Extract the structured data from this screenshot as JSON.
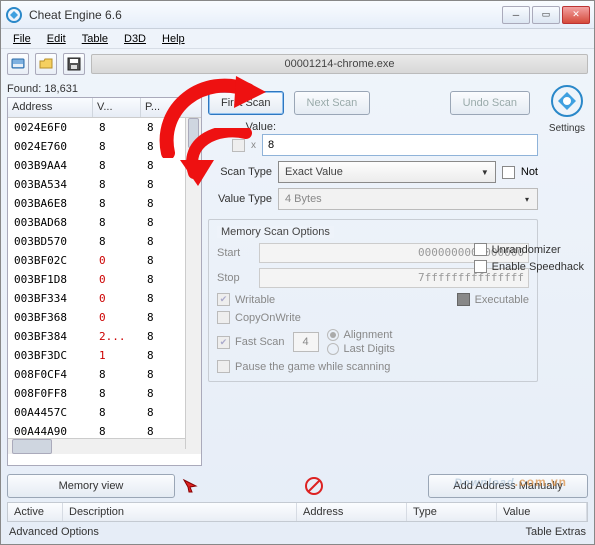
{
  "window": {
    "title": "Cheat Engine 6.6"
  },
  "menu": {
    "file": "File",
    "edit": "Edit",
    "table": "Table",
    "d3d": "D3D",
    "help": "Help"
  },
  "process": "00001214-chrome.exe",
  "found": {
    "label": "Found:",
    "count": "18,631"
  },
  "columns": {
    "address": "Address",
    "value": "V...",
    "prev": "P..."
  },
  "rows": [
    {
      "a": "0024E6F0",
      "v": "8",
      "p": "8",
      "r": false
    },
    {
      "a": "0024E760",
      "v": "8",
      "p": "8",
      "r": false
    },
    {
      "a": "003B9AA4",
      "v": "8",
      "p": "8",
      "r": false
    },
    {
      "a": "003BA534",
      "v": "8",
      "p": "8",
      "r": false
    },
    {
      "a": "003BA6E8",
      "v": "8",
      "p": "8",
      "r": false
    },
    {
      "a": "003BAD68",
      "v": "8",
      "p": "8",
      "r": false
    },
    {
      "a": "003BD570",
      "v": "8",
      "p": "8",
      "r": false
    },
    {
      "a": "003BF02C",
      "v": "0",
      "p": "8",
      "r": true
    },
    {
      "a": "003BF1D8",
      "v": "0",
      "p": "8",
      "r": true
    },
    {
      "a": "003BF334",
      "v": "0",
      "p": "8",
      "r": true
    },
    {
      "a": "003BF368",
      "v": "0",
      "p": "8",
      "r": true
    },
    {
      "a": "003BF384",
      "v": "2...",
      "p": "8",
      "r": true
    },
    {
      "a": "003BF3DC",
      "v": "1",
      "p": "8",
      "r": true
    },
    {
      "a": "008F0CF4",
      "v": "8",
      "p": "8",
      "r": false
    },
    {
      "a": "008F0FF8",
      "v": "8",
      "p": "8",
      "r": false
    },
    {
      "a": "00A4457C",
      "v": "8",
      "p": "8",
      "r": false
    },
    {
      "a": "00A44A90",
      "v": "8",
      "p": "8",
      "r": false
    }
  ],
  "scan": {
    "first": "First Scan",
    "next": "Next Scan",
    "undo": "Undo Scan",
    "settings": "Settings",
    "value_label": "Value:",
    "value": "8",
    "hex_chk": "x",
    "scantype_label": "Scan Type",
    "scantype": "Exact Value",
    "not": "Not",
    "valuetype_label": "Value Type",
    "valuetype": "4 Bytes"
  },
  "mso": {
    "legend": "Memory Scan Options",
    "start_label": "Start",
    "start_val": "0000000000000000",
    "stop_label": "Stop",
    "stop_val": "7fffffffffffffff",
    "writable": "Writable",
    "executable": "Executable",
    "cow": "CopyOnWrite",
    "fastscan": "Fast Scan",
    "fastscan_val": "4",
    "alignment": "Alignment",
    "lastdigits": "Last Digits",
    "pause": "Pause the game while scanning"
  },
  "rightchk": {
    "unrand": "Unrandomizer",
    "speedhack": "Enable Speedhack"
  },
  "bottom": {
    "memview": "Memory view",
    "addmanual": "Add Address Manually",
    "cols": {
      "active": "Active",
      "desc": "Description",
      "addr": "Address",
      "type": "Type",
      "value": "Value"
    },
    "advopt": "Advanced Options",
    "extras": "Table Extras"
  },
  "watermark": {
    "main": "Download",
    "ext": ".com.vn"
  }
}
